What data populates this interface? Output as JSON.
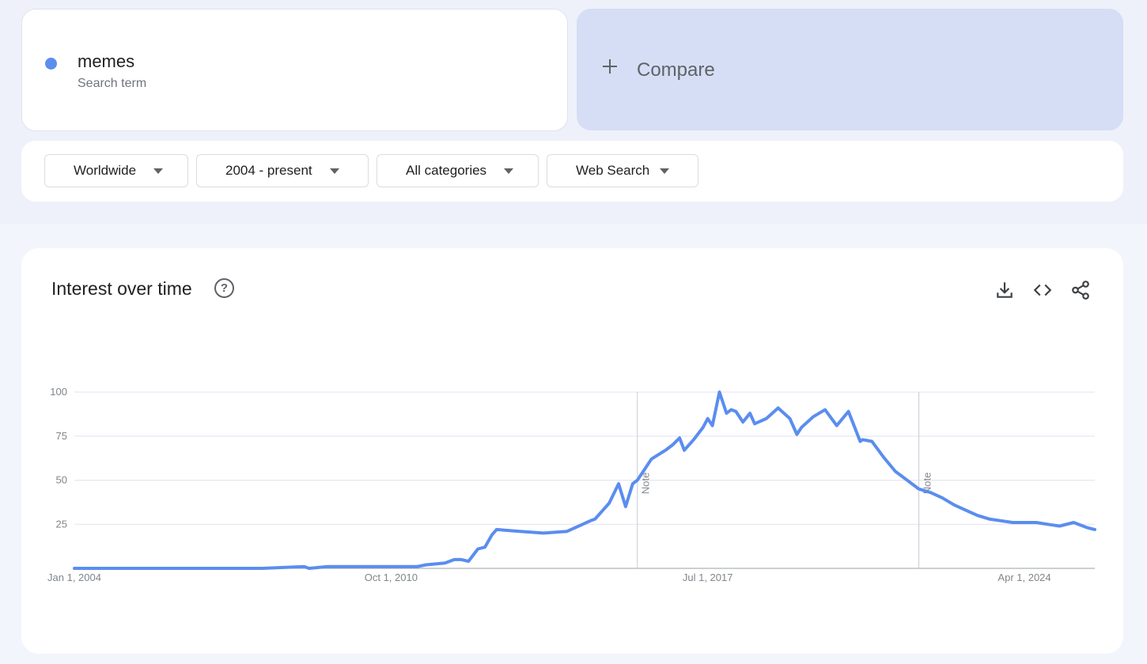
{
  "search_term": {
    "name": "memes",
    "type": "Search term",
    "color": "#5b8def"
  },
  "compare": {
    "label": "Compare",
    "icon": "plus-icon"
  },
  "filters": [
    {
      "id": "region",
      "label": "Worldwide"
    },
    {
      "id": "time-range",
      "label": "2004 - present"
    },
    {
      "id": "category",
      "label": "All categories"
    },
    {
      "id": "search-type",
      "label": "Web Search"
    }
  ],
  "chart_card": {
    "title": "Interest over time",
    "help_icon": "question-mark-circle-icon",
    "actions": [
      "download-icon",
      "embed-code-icon",
      "share-icon"
    ]
  },
  "chart_data": {
    "type": "line",
    "ylim": [
      0,
      100
    ],
    "yticks": [
      100,
      75,
      50,
      25
    ],
    "xtick_labels": [
      {
        "label": "Jan 1, 2004",
        "year": 2004.0
      },
      {
        "label": "Oct 1, 2010",
        "year": 2010.75
      },
      {
        "label": "Jul 1, 2017",
        "year": 2017.5
      },
      {
        "label": "Apr 1, 2024",
        "year": 2024.25
      }
    ],
    "notes": [
      {
        "label": "Note",
        "year": 2016.0
      },
      {
        "label": "Note",
        "year": 2022.0
      }
    ],
    "line_color": "#5b8def",
    "series": [
      {
        "x": [
          2004.0,
          2005.0,
          2006.0,
          2007.0,
          2008.0,
          2008.9,
          2009.0,
          2009.4,
          2010.0,
          2010.5,
          2011.0,
          2011.3,
          2011.5,
          2011.9,
          2012.1,
          2012.25,
          2012.4,
          2012.6,
          2012.75,
          2012.9,
          2013.0,
          2013.5,
          2014.0,
          2014.5,
          2015.0,
          2015.1,
          2015.4,
          2015.6,
          2015.75,
          2015.9,
          2016.0,
          2016.1,
          2016.3,
          2016.6,
          2016.75,
          2016.9,
          2017.0,
          2017.2,
          2017.4,
          2017.5,
          2017.6,
          2017.75,
          2017.9,
          2018.0,
          2018.1,
          2018.25,
          2018.4,
          2018.5,
          2018.75,
          2019.0,
          2019.25,
          2019.4,
          2019.5,
          2019.75,
          2020.0,
          2020.25,
          2020.5,
          2020.75,
          2020.8,
          2021.0,
          2021.25,
          2021.5,
          2021.75,
          2022.0,
          2022.25,
          2022.5,
          2022.75,
          2023.0,
          2023.25,
          2023.5,
          2023.75,
          2024.0,
          2024.25,
          2024.5,
          2024.75,
          2025.0,
          2025.3,
          2025.6,
          2025.75
        ],
        "y": [
          0,
          0,
          0,
          0,
          0,
          1,
          0,
          1,
          1,
          1,
          1,
          1,
          2,
          3,
          5,
          5,
          4,
          11,
          12,
          19,
          22,
          21,
          20,
          21,
          27,
          28,
          37,
          48,
          35,
          48,
          50,
          54,
          62,
          67,
          70,
          74,
          67,
          73,
          80,
          85,
          81,
          100,
          88,
          90,
          89,
          83,
          88,
          82,
          85,
          91,
          85,
          76,
          80,
          86,
          90,
          81,
          89,
          72,
          73,
          72,
          63,
          55,
          50,
          45,
          43,
          40,
          36,
          33,
          30,
          28,
          27,
          26,
          26,
          26,
          25,
          24,
          26,
          23,
          22
        ]
      }
    ]
  }
}
